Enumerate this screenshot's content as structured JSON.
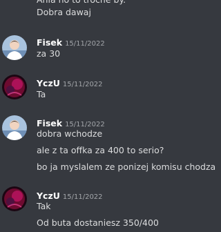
{
  "messages_before": [
    {
      "text": "Ania no to troche by."
    },
    {
      "text": "Dobra dawaj"
    }
  ],
  "groups": [
    {
      "username": "Fisek",
      "timestamp": "15/11/2022",
      "avatar": "fisek-avatar",
      "lines": [
        "za 30"
      ]
    },
    {
      "username": "YczU",
      "timestamp": "15/11/2022",
      "avatar": "yczu-avatar",
      "lines": [
        "Ta"
      ]
    },
    {
      "username": "Fisek",
      "timestamp": "15/11/2022",
      "avatar": "fisek-avatar",
      "lines": [
        "dobra wchodze",
        "ale z ta offka za 400 to serio?",
        "bo ja myslalem ze ponizej komisu chodza"
      ]
    },
    {
      "username": "YczU",
      "timestamp": "15/11/2022",
      "avatar": "yczu-avatar",
      "lines": [
        "Tak",
        "Od buta dostaniesz 350/400"
      ]
    }
  ],
  "colors": {
    "background": "#36393f",
    "username": "#ffffff",
    "message_text": "#dcddde",
    "timestamp": "#a3a6aa"
  }
}
